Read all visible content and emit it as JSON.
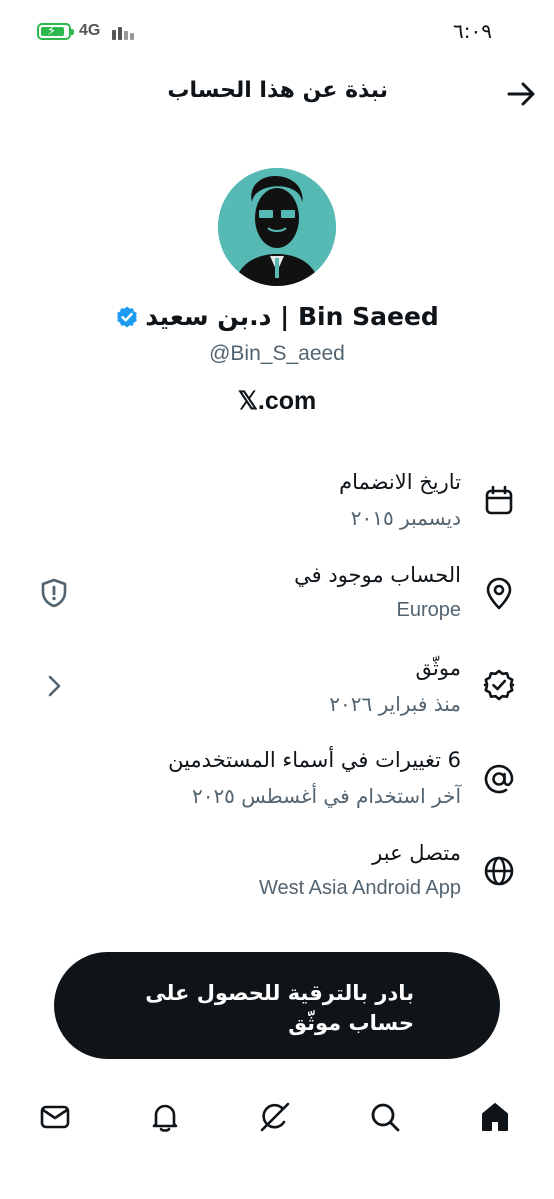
{
  "status_bar": {
    "network": "4G",
    "time": "٦:٠٩",
    "battery_level": 0.75,
    "battery_color": "#2db84d"
  },
  "header": {
    "title": "نبذة عن هذا الحساب",
    "back_icon": "arrow-right-icon"
  },
  "profile": {
    "display_name": "د.بن سعيد | Bin Saeed",
    "handle": "@Bin_S_aeed",
    "site": "𝕏.com",
    "verified_color": "#1d9bf0",
    "avatar_bg": "#57b9b3"
  },
  "info": [
    {
      "title": "تاريخ الانضمام",
      "subtitle": "ديسمبر ٢٠١٥",
      "icon": "calendar-icon"
    },
    {
      "title": "الحساب موجود في",
      "subtitle": "Europe",
      "icon": "location-pin-icon",
      "side_icon": "shield-alert-icon"
    },
    {
      "title": "موثّق",
      "subtitle": "منذ فبراير ٢٠٢٦",
      "icon": "verified-badge-icon",
      "side_icon": "chevron-icon"
    },
    {
      "title": "6 تغييرات في أسماء المستخدمين",
      "subtitle": "آخر استخدام في أغسطس ٢٠٢٥",
      "icon": "at-sign-icon"
    },
    {
      "title": "متصل عبر",
      "subtitle": "West Asia Android App",
      "icon": "globe-icon"
    }
  ],
  "upgrade": {
    "label": "بادر بالترقية للحصول على حساب موثّق"
  },
  "bottom_nav": [
    "mail-icon",
    "bell-icon",
    "grok-icon",
    "search-icon",
    "home-icon"
  ]
}
